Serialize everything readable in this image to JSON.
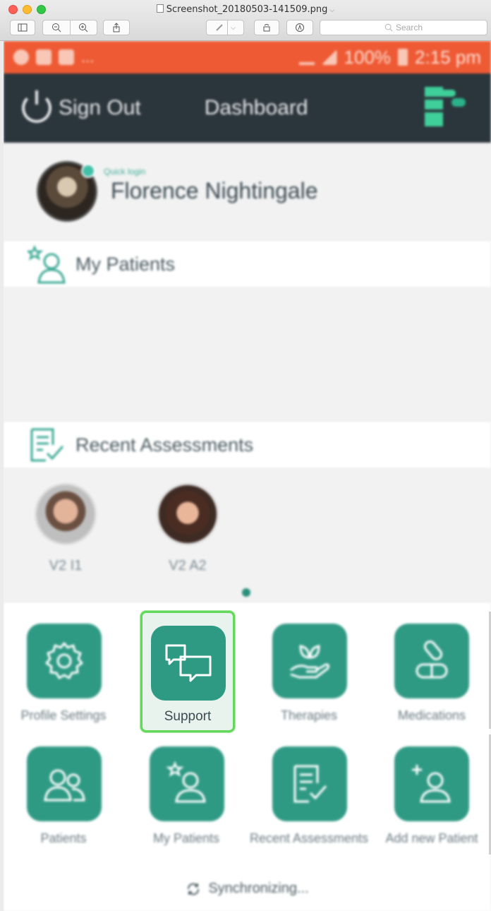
{
  "window": {
    "title": "Screenshot_20180503-141509.png",
    "search_placeholder": "Search"
  },
  "statusbar": {
    "dots": "...",
    "battery": "100%",
    "time": "2:15 pm"
  },
  "appbar": {
    "signout_label": "Sign Out",
    "dashboard_label": "Dashboard"
  },
  "profile": {
    "quick_login": "Quick login",
    "name": "Florence Nightingale"
  },
  "sections": {
    "my_patients": "My Patients",
    "recent_assessments": "Recent Assessments"
  },
  "recent_patients": [
    {
      "label": "V2 I1"
    },
    {
      "label": "V2 A2"
    }
  ],
  "tiles": [
    {
      "label": "Profile Settings",
      "icon": "gear-icon"
    },
    {
      "label": "Support",
      "icon": "chat-bubbles-icon"
    },
    {
      "label": "Therapies",
      "icon": "leaf-hand-icon"
    },
    {
      "label": "Medications",
      "icon": "pills-icon"
    },
    {
      "label": "Patients",
      "icon": "users-icon"
    },
    {
      "label": "My Patients",
      "icon": "star-user-icon"
    },
    {
      "label": "Recent Assessments",
      "icon": "checklist-icon"
    },
    {
      "label": "Add new Patient",
      "icon": "add-user-icon"
    }
  ],
  "sync_text": "Synchronizing...",
  "colors": {
    "statusbar": "#ee5a34",
    "appbar": "#2b353c",
    "tile": "#2f9a84",
    "highlight": "#63d95b"
  }
}
